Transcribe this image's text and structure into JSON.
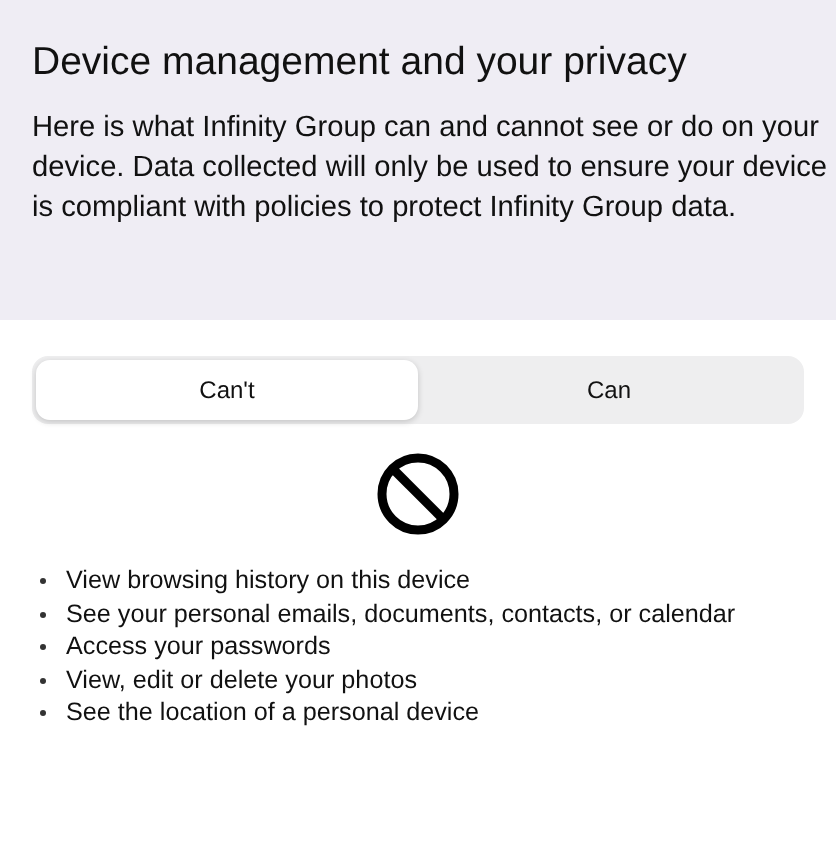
{
  "header": {
    "title": "Device management and your privacy",
    "description": "Here is what Infinity Group can and cannot see or do on your device. Data collected will only be used to ensure your device is compliant with policies to protect Infinity Group data."
  },
  "segments": [
    {
      "label": "Can't",
      "selected": true
    },
    {
      "label": "Can",
      "selected": false
    }
  ],
  "items": [
    "View browsing history on this device",
    "See your personal emails, documents, contacts, or calendar",
    "Access your passwords",
    "View, edit or delete your photos",
    "See the location of a personal device"
  ]
}
